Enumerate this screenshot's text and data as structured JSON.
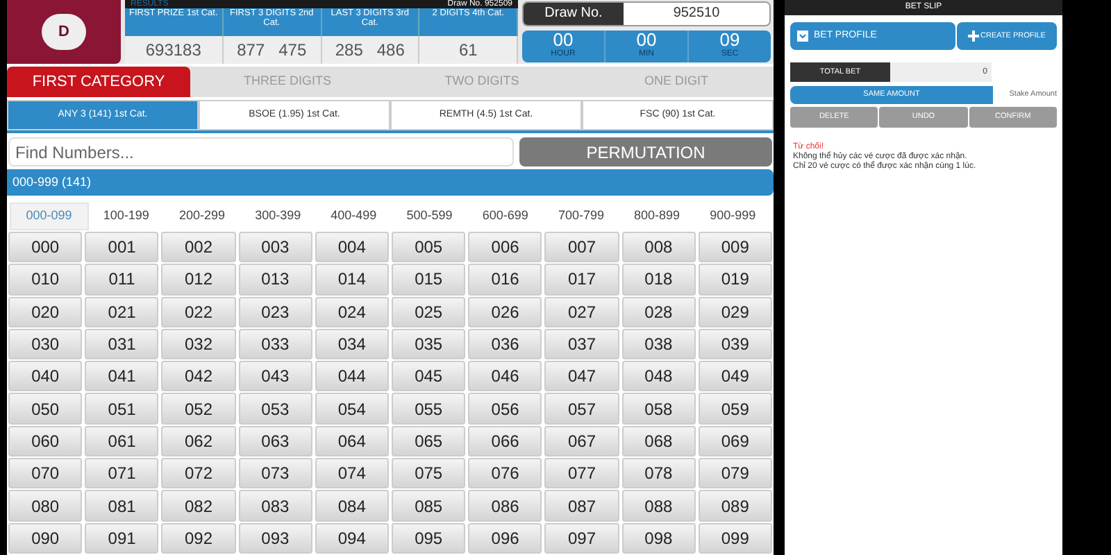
{
  "logo": {
    "letter": "D"
  },
  "results": {
    "title": "RESULTS",
    "draw_no": "Draw No. 952509",
    "columns": [
      {
        "label": "FIRST PRIZE 1st Cat.",
        "value": "693183"
      },
      {
        "label": "FIRST 3 DIGITS 2nd Cat.",
        "value": "877   475"
      },
      {
        "label": "LAST 3 DIGITS 3rd Cat.",
        "value": "285   486"
      },
      {
        "label": "2 DIGITS 4th Cat.",
        "value": "61"
      }
    ]
  },
  "draw": {
    "label": "Draw No.",
    "value": "952510",
    "countdown": [
      {
        "value": "00",
        "unit": "HOUR"
      },
      {
        "value": "00",
        "unit": "MIN"
      },
      {
        "value": "09",
        "unit": "SEC"
      }
    ]
  },
  "category_tabs": [
    {
      "label": "FIRST CATEGORY",
      "selected": true
    },
    {
      "label": "THREE DIGITS",
      "selected": false
    },
    {
      "label": "TWO DIGITS",
      "selected": false
    },
    {
      "label": "ONE DIGIT",
      "selected": false
    }
  ],
  "bet_tabs": [
    {
      "label": "ANY 3 (141) 1st Cat.",
      "selected": true
    },
    {
      "label": "BSOE (1.95) 1st Cat.",
      "selected": false
    },
    {
      "label": "REMTH (4.5) 1st Cat.",
      "selected": false
    },
    {
      "label": "FSC (90) 1st Cat.",
      "selected": false
    }
  ],
  "search": {
    "placeholder": "Find Numbers..."
  },
  "permutation_button": "PERMUTATION",
  "range_bar": "000-999 (141)",
  "ranges": [
    {
      "label": "000-099",
      "selected": true
    },
    {
      "label": "100-199",
      "selected": false
    },
    {
      "label": "200-299",
      "selected": false
    },
    {
      "label": "300-399",
      "selected": false
    },
    {
      "label": "400-499",
      "selected": false
    },
    {
      "label": "500-599",
      "selected": false
    },
    {
      "label": "600-699",
      "selected": false
    },
    {
      "label": "700-799",
      "selected": false
    },
    {
      "label": "800-899",
      "selected": false
    },
    {
      "label": "900-999",
      "selected": false
    }
  ],
  "numbers": [
    "000",
    "001",
    "002",
    "003",
    "004",
    "005",
    "006",
    "007",
    "008",
    "009",
    "010",
    "011",
    "012",
    "013",
    "014",
    "015",
    "016",
    "017",
    "018",
    "019",
    "020",
    "021",
    "022",
    "023",
    "024",
    "025",
    "026",
    "027",
    "028",
    "029",
    "030",
    "031",
    "032",
    "033",
    "034",
    "035",
    "036",
    "037",
    "038",
    "039",
    "040",
    "041",
    "042",
    "043",
    "044",
    "045",
    "046",
    "047",
    "048",
    "049",
    "050",
    "051",
    "052",
    "053",
    "054",
    "055",
    "056",
    "057",
    "058",
    "059",
    "060",
    "061",
    "062",
    "063",
    "064",
    "065",
    "066",
    "067",
    "068",
    "069",
    "070",
    "071",
    "072",
    "073",
    "074",
    "075",
    "076",
    "077",
    "078",
    "079",
    "080",
    "081",
    "082",
    "083",
    "084",
    "085",
    "086",
    "087",
    "088",
    "089",
    "090",
    "091",
    "092",
    "093",
    "094",
    "095",
    "096",
    "097",
    "098",
    "099"
  ],
  "bet_slip": {
    "title": "BET SLIP",
    "profile": {
      "label": "BET PROFILE",
      "checked": true
    },
    "create_profile": "CREATE PROFILE",
    "total_bet": {
      "label": "TOTAL BET",
      "value": "0"
    },
    "amount_modes": [
      {
        "label": "SAME AMOUNT",
        "selected": true
      },
      {
        "label": "Stake Amount",
        "selected": false
      }
    ],
    "actions": [
      "DELETE",
      "UNDO",
      "CONFIRM"
    ],
    "notice_title": "Từ chối!",
    "notice_lines": [
      "Không thể hủy các vé cược đã được xác nhận.",
      "Chỉ 20 vé cược có thể được xác nhận cùng 1 lúc."
    ]
  }
}
